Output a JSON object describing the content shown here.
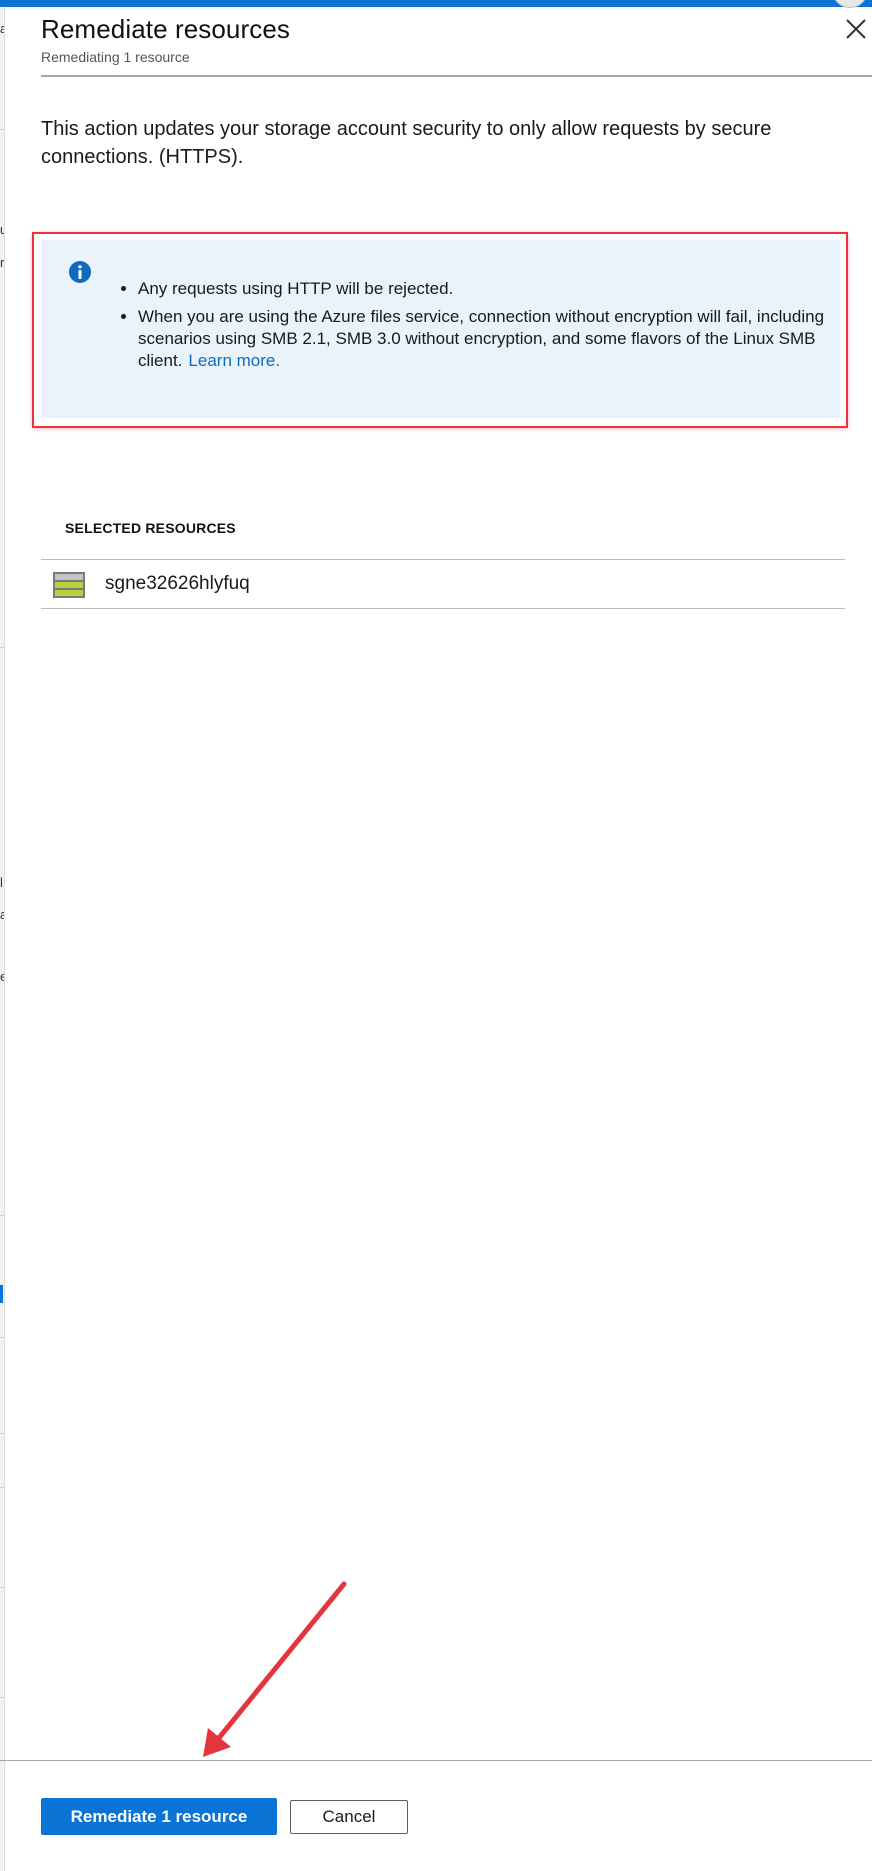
{
  "panel": {
    "title": "Remediate resources",
    "subtitle": "Remediating 1 resource",
    "close_icon": "close-icon"
  },
  "description": "This action updates your storage account security to only allow requests by secure connections. (HTTPS).",
  "info": {
    "icon": "info-icon",
    "items": [
      "Any requests using HTTP will be rejected.",
      "When you are using the Azure files service, connection without encryption will fail, including scenarios using SMB 2.1, SMB 3.0 without encryption, and some flavors of the Linux SMB client."
    ],
    "link_text": "Learn more."
  },
  "selected_resources": {
    "heading": "SELECTED RESOURCES",
    "items": [
      {
        "name": "sgne32626hlyfuq",
        "icon": "storage-account-icon"
      }
    ]
  },
  "actions": {
    "primary_label": "Remediate 1 resource",
    "secondary_label": "Cancel"
  },
  "background_fragments": [
    "a",
    "u",
    "r",
    "l",
    "a",
    "e"
  ],
  "colors": {
    "accent": "#0a73d4",
    "info_background": "#eaf3fc",
    "highlight_border": "#e3353e",
    "link": "#0f6cbd"
  }
}
